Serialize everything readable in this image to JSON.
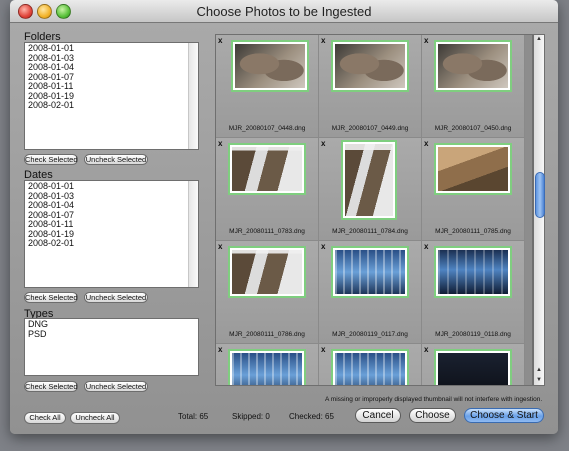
{
  "window": {
    "title": "Choose Photos to be Ingested"
  },
  "folders": {
    "label": "Folders",
    "items": [
      "2008-01-01",
      "2008-01-03",
      "2008-01-04",
      "2008-01-07",
      "2008-01-11",
      "2008-01-19",
      "2008-02-01"
    ],
    "check_label": "Check Selected",
    "uncheck_label": "Uncheck Selected"
  },
  "dates": {
    "label": "Dates",
    "items": [
      "2008-01-01",
      "2008-01-03",
      "2008-01-04",
      "2008-01-07",
      "2008-01-11",
      "2008-01-19",
      "2008-02-01"
    ],
    "check_label": "Check Selected",
    "uncheck_label": "Uncheck Selected"
  },
  "types": {
    "label": "Types",
    "items": [
      "DNG",
      "PSD"
    ],
    "check_label": "Check Selected",
    "uncheck_label": "Uncheck Selected"
  },
  "thumbnails": [
    {
      "x_label": "x",
      "filename": "MJR_20080107_0448.dng",
      "kind": "rocks"
    },
    {
      "x_label": "x",
      "filename": "MJR_20080107_0449.dng",
      "kind": "rocks"
    },
    {
      "x_label": "x",
      "filename": "MJR_20080107_0450.dng",
      "kind": "rocks"
    },
    {
      "x_label": "x",
      "filename": "MJR_20080111_0783.dng",
      "kind": "stream"
    },
    {
      "x_label": "x",
      "filename": "MJR_20080111_0784.dng",
      "kind": "stream"
    },
    {
      "x_label": "x",
      "filename": "MJR_20080111_0785.dng",
      "kind": "cliff"
    },
    {
      "x_label": "x",
      "filename": "MJR_20080111_0786.dng",
      "kind": "stream"
    },
    {
      "x_label": "x",
      "filename": "MJR_20080119_0117.dng",
      "kind": "glass"
    },
    {
      "x_label": "x",
      "filename": "MJR_20080119_0118.dng",
      "kind": "glass-dark"
    },
    {
      "x_label": "x",
      "filename": "",
      "kind": "glass"
    },
    {
      "x_label": "x",
      "filename": "",
      "kind": "glass"
    },
    {
      "x_label": "x",
      "filename": "",
      "kind": "dark"
    }
  ],
  "footnote": "A missing or improperly displayed thumbnail will not interfere with ingestion.",
  "footer": {
    "check_all": "Check All",
    "uncheck_all": "Uncheck All",
    "total": "Total: 65",
    "skipped": "Skipped: 0",
    "checked": "Checked: 65",
    "cancel": "Cancel",
    "choose": "Choose",
    "choose_start": "Choose & Start"
  },
  "colors": {
    "accent": "#6aa1e8",
    "thumb_border": "#7fce7f"
  }
}
